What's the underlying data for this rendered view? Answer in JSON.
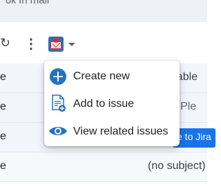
{
  "header": {
    "title": "ок In mail"
  },
  "toolbar": {
    "refresh_glyph": "↻",
    "more_glyph": "⋮",
    "extension_icon": "jira-mail-icon"
  },
  "rows": [
    {
      "left": "e",
      "right": "g table"
    },
    {
      "left": "e",
      "right": "g - Ple"
    },
    {
      "left": "e",
      "right": "e to Jira"
    },
    {
      "left": "e",
      "right": "(no subject)"
    }
  ],
  "menu": {
    "items": [
      {
        "label": "Create new",
        "icon": "plus-circle-icon"
      },
      {
        "label": "Add to issue",
        "icon": "document-add-icon"
      },
      {
        "label": "View related issues",
        "icon": "eye-icon"
      }
    ]
  },
  "colors": {
    "accent": "#1f73c7",
    "chip": "#1a73e8",
    "row_bg": "#f2f6fc"
  }
}
